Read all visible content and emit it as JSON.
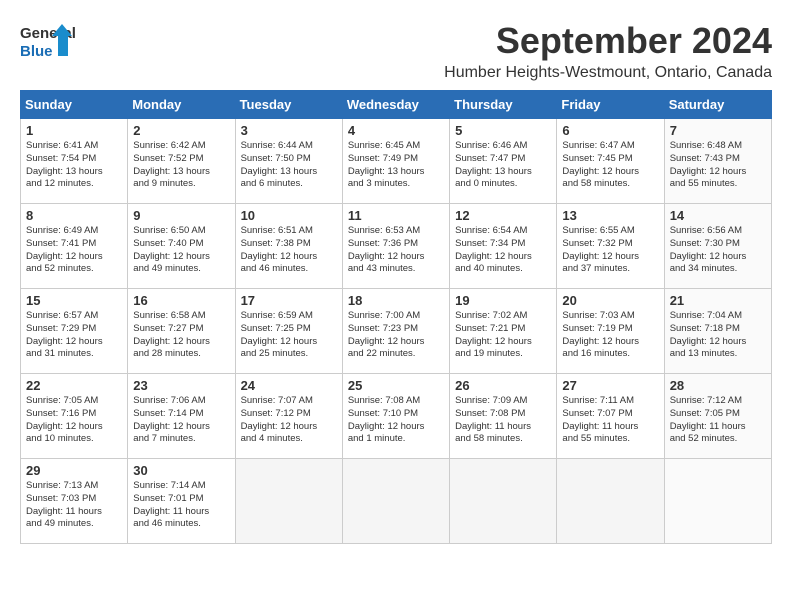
{
  "header": {
    "logo_line1": "General",
    "logo_line2": "Blue",
    "month_title": "September 2024",
    "location": "Humber Heights-Westmount, Ontario, Canada"
  },
  "days_of_week": [
    "Sunday",
    "Monday",
    "Tuesday",
    "Wednesday",
    "Thursday",
    "Friday",
    "Saturday"
  ],
  "weeks": [
    [
      {
        "day": "1",
        "info": "Sunrise: 6:41 AM\nSunset: 7:54 PM\nDaylight: 13 hours\nand 12 minutes."
      },
      {
        "day": "2",
        "info": "Sunrise: 6:42 AM\nSunset: 7:52 PM\nDaylight: 13 hours\nand 9 minutes."
      },
      {
        "day": "3",
        "info": "Sunrise: 6:44 AM\nSunset: 7:50 PM\nDaylight: 13 hours\nand 6 minutes."
      },
      {
        "day": "4",
        "info": "Sunrise: 6:45 AM\nSunset: 7:49 PM\nDaylight: 13 hours\nand 3 minutes."
      },
      {
        "day": "5",
        "info": "Sunrise: 6:46 AM\nSunset: 7:47 PM\nDaylight: 13 hours\nand 0 minutes."
      },
      {
        "day": "6",
        "info": "Sunrise: 6:47 AM\nSunset: 7:45 PM\nDaylight: 12 hours\nand 58 minutes."
      },
      {
        "day": "7",
        "info": "Sunrise: 6:48 AM\nSunset: 7:43 PM\nDaylight: 12 hours\nand 55 minutes."
      }
    ],
    [
      {
        "day": "8",
        "info": "Sunrise: 6:49 AM\nSunset: 7:41 PM\nDaylight: 12 hours\nand 52 minutes."
      },
      {
        "day": "9",
        "info": "Sunrise: 6:50 AM\nSunset: 7:40 PM\nDaylight: 12 hours\nand 49 minutes."
      },
      {
        "day": "10",
        "info": "Sunrise: 6:51 AM\nSunset: 7:38 PM\nDaylight: 12 hours\nand 46 minutes."
      },
      {
        "day": "11",
        "info": "Sunrise: 6:53 AM\nSunset: 7:36 PM\nDaylight: 12 hours\nand 43 minutes."
      },
      {
        "day": "12",
        "info": "Sunrise: 6:54 AM\nSunset: 7:34 PM\nDaylight: 12 hours\nand 40 minutes."
      },
      {
        "day": "13",
        "info": "Sunrise: 6:55 AM\nSunset: 7:32 PM\nDaylight: 12 hours\nand 37 minutes."
      },
      {
        "day": "14",
        "info": "Sunrise: 6:56 AM\nSunset: 7:30 PM\nDaylight: 12 hours\nand 34 minutes."
      }
    ],
    [
      {
        "day": "15",
        "info": "Sunrise: 6:57 AM\nSunset: 7:29 PM\nDaylight: 12 hours\nand 31 minutes."
      },
      {
        "day": "16",
        "info": "Sunrise: 6:58 AM\nSunset: 7:27 PM\nDaylight: 12 hours\nand 28 minutes."
      },
      {
        "day": "17",
        "info": "Sunrise: 6:59 AM\nSunset: 7:25 PM\nDaylight: 12 hours\nand 25 minutes."
      },
      {
        "day": "18",
        "info": "Sunrise: 7:00 AM\nSunset: 7:23 PM\nDaylight: 12 hours\nand 22 minutes."
      },
      {
        "day": "19",
        "info": "Sunrise: 7:02 AM\nSunset: 7:21 PM\nDaylight: 12 hours\nand 19 minutes."
      },
      {
        "day": "20",
        "info": "Sunrise: 7:03 AM\nSunset: 7:19 PM\nDaylight: 12 hours\nand 16 minutes."
      },
      {
        "day": "21",
        "info": "Sunrise: 7:04 AM\nSunset: 7:18 PM\nDaylight: 12 hours\nand 13 minutes."
      }
    ],
    [
      {
        "day": "22",
        "info": "Sunrise: 7:05 AM\nSunset: 7:16 PM\nDaylight: 12 hours\nand 10 minutes."
      },
      {
        "day": "23",
        "info": "Sunrise: 7:06 AM\nSunset: 7:14 PM\nDaylight: 12 hours\nand 7 minutes."
      },
      {
        "day": "24",
        "info": "Sunrise: 7:07 AM\nSunset: 7:12 PM\nDaylight: 12 hours\nand 4 minutes."
      },
      {
        "day": "25",
        "info": "Sunrise: 7:08 AM\nSunset: 7:10 PM\nDaylight: 12 hours\nand 1 minute."
      },
      {
        "day": "26",
        "info": "Sunrise: 7:09 AM\nSunset: 7:08 PM\nDaylight: 11 hours\nand 58 minutes."
      },
      {
        "day": "27",
        "info": "Sunrise: 7:11 AM\nSunset: 7:07 PM\nDaylight: 11 hours\nand 55 minutes."
      },
      {
        "day": "28",
        "info": "Sunrise: 7:12 AM\nSunset: 7:05 PM\nDaylight: 11 hours\nand 52 minutes."
      }
    ],
    [
      {
        "day": "29",
        "info": "Sunrise: 7:13 AM\nSunset: 7:03 PM\nDaylight: 11 hours\nand 49 minutes."
      },
      {
        "day": "30",
        "info": "Sunrise: 7:14 AM\nSunset: 7:01 PM\nDaylight: 11 hours\nand 46 minutes."
      },
      {
        "day": "",
        "info": ""
      },
      {
        "day": "",
        "info": ""
      },
      {
        "day": "",
        "info": ""
      },
      {
        "day": "",
        "info": ""
      },
      {
        "day": "",
        "info": ""
      }
    ]
  ]
}
